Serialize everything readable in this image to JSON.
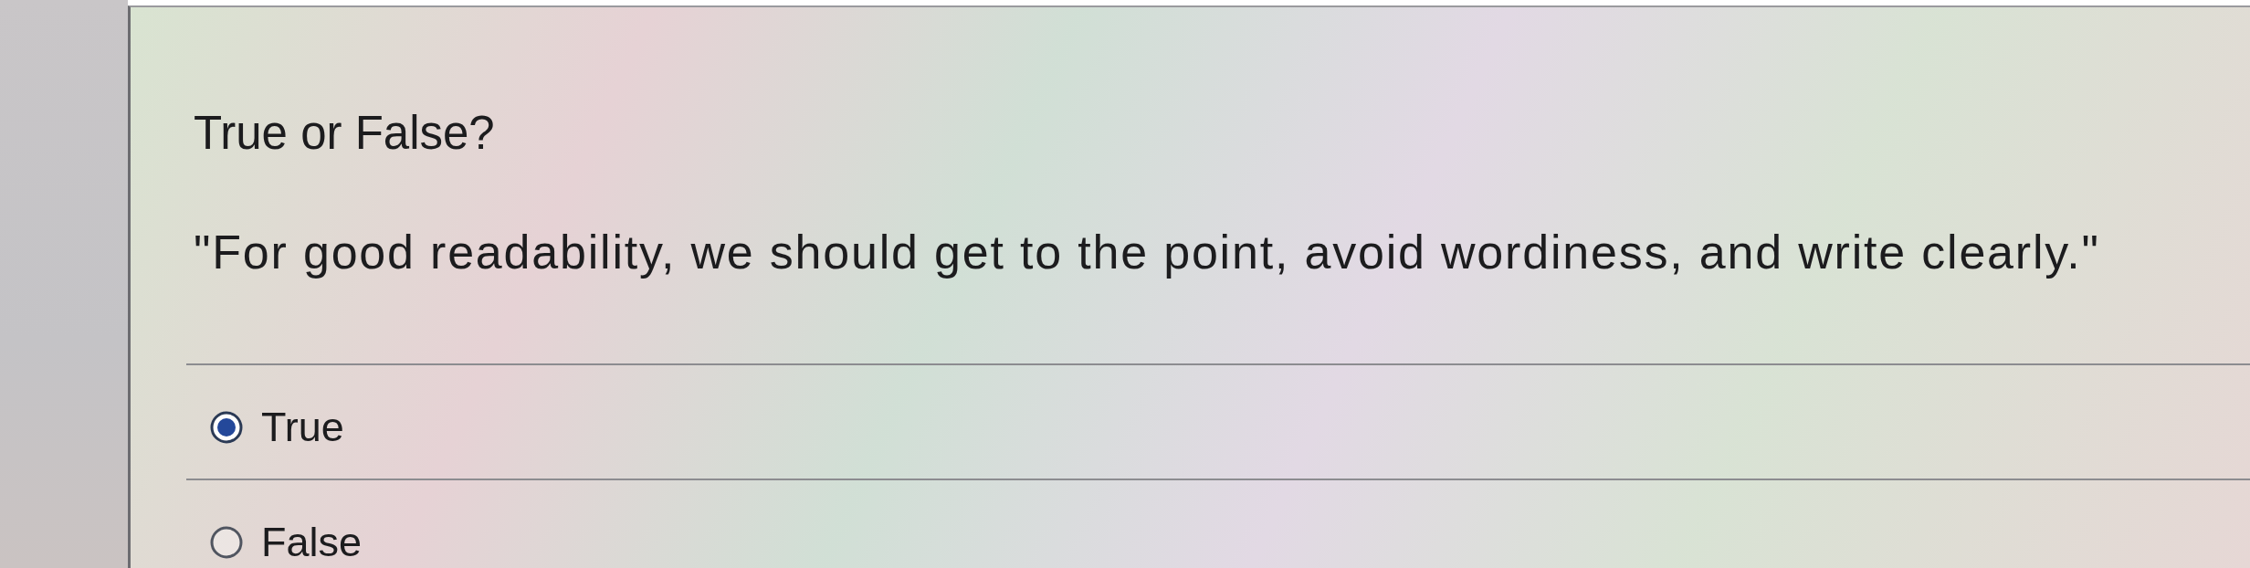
{
  "question": {
    "title": "True or False?",
    "prompt": "\"For good readability, we should get to the point, avoid wordiness, and write clearly.\""
  },
  "options": [
    {
      "label": "True",
      "selected": true
    },
    {
      "label": "False",
      "selected": false
    }
  ]
}
